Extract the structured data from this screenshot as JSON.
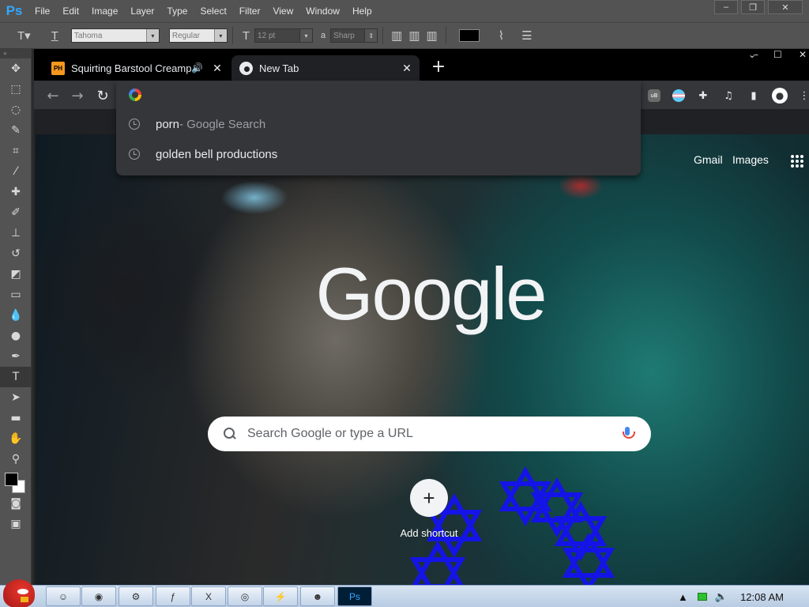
{
  "photoshop": {
    "logo": "Ps",
    "menu": [
      "File",
      "Edit",
      "Image",
      "Layer",
      "Type",
      "Select",
      "Filter",
      "View",
      "Window",
      "Help"
    ],
    "options": {
      "font_family": "Tahoma",
      "font_style": "Regular",
      "font_size": "12 pt",
      "antialias_label": "a",
      "antialias": "Sharp",
      "text_color": "#000000"
    },
    "window_controls": [
      "–",
      "❐",
      "✕"
    ],
    "tools_header": "»"
  },
  "chrome": {
    "tabs": [
      {
        "favicon": "PH",
        "title": "Squirting Barstool Creampie",
        "audio": "🔊",
        "close": "✕"
      },
      {
        "favicon": "chrome",
        "title": "New Tab",
        "close": "✕"
      }
    ],
    "new_tab": "+",
    "window_controls": [
      "⌄",
      "–",
      "☐",
      "✕"
    ],
    "nav": {
      "back": "←",
      "forward": "→",
      "reload": "↻"
    },
    "extensions": {
      "ublock": "uB",
      "puzzle": "✚",
      "media": "♫",
      "sidepanel": "▮",
      "avatar": "●",
      "menu": "⋮"
    },
    "omnibox": {
      "suggestions": [
        {
          "primary": "porn",
          "secondary": " - Google Search"
        },
        {
          "primary": "golden bell productions",
          "secondary": ""
        }
      ]
    }
  },
  "ntp": {
    "gmail": "Gmail",
    "images": "Images",
    "logo": "Google",
    "search_placeholder": "Search Google or type a URL",
    "add_shortcut": "Add shortcut",
    "shortcut_plus": "+"
  },
  "taskbar": {
    "buttons": [
      "☺",
      "◉",
      "⚙",
      "ƒ",
      "X",
      "◎",
      "⚡",
      "☻",
      "Ps"
    ],
    "clock": "12:08 AM"
  }
}
